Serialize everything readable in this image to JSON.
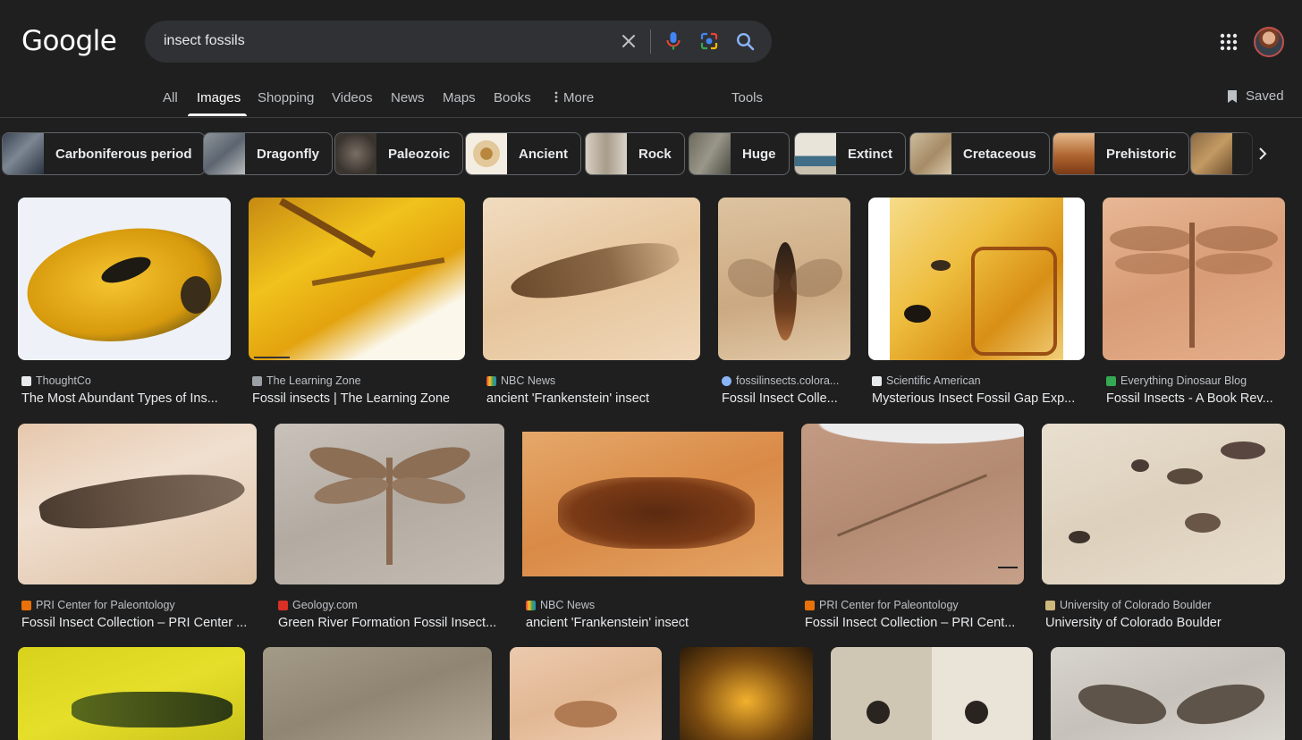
{
  "logo": "Google",
  "search": {
    "query": "insect fossils"
  },
  "nav": {
    "tabs": [
      "All",
      "Images",
      "Shopping",
      "Videos",
      "News",
      "Maps",
      "Books",
      "More"
    ],
    "active": "Images",
    "tools": "Tools",
    "saved": "Saved"
  },
  "chips": [
    {
      "label": "Carboniferous period"
    },
    {
      "label": "Dragonfly"
    },
    {
      "label": "Paleozoic"
    },
    {
      "label": "Ancient"
    },
    {
      "label": "Rock"
    },
    {
      "label": "Huge"
    },
    {
      "label": "Extinct"
    },
    {
      "label": "Cretaceous"
    },
    {
      "label": "Prehistoric"
    }
  ],
  "results": {
    "row1": [
      {
        "source": "ThoughtCo",
        "title": "The Most Abundant Types of Ins..."
      },
      {
        "source": "The Learning Zone",
        "title": "Fossil insects | The Learning Zone"
      },
      {
        "source": "NBC News",
        "title": "ancient 'Frankenstein' insect"
      },
      {
        "source": "fossilinsects.colora...",
        "title": "Fossil Insect Colle..."
      },
      {
        "source": "Scientific American",
        "title": "Mysterious Insect Fossil Gap Exp..."
      },
      {
        "source": "Everything Dinosaur Blog",
        "title": "Fossil Insects - A Book Rev..."
      }
    ],
    "row2": [
      {
        "source": "PRI Center for Paleontology",
        "title": "Fossil Insect Collection – PRI Center ..."
      },
      {
        "source": "Geology.com",
        "title": "Green River Formation Fossil Insect..."
      },
      {
        "source": "NBC News",
        "title": "ancient 'Frankenstein' insect"
      },
      {
        "source": "PRI Center for Paleontology",
        "title": "Fossil Insect Collection – PRI Cent..."
      },
      {
        "source": "University of Colorado Boulder",
        "title": "University of Colorado Boulder"
      }
    ]
  },
  "colors": {
    "background": "#1f1f1f",
    "searchbox": "#303134",
    "text": "#e8eaed",
    "muted": "#bdc1c6"
  }
}
